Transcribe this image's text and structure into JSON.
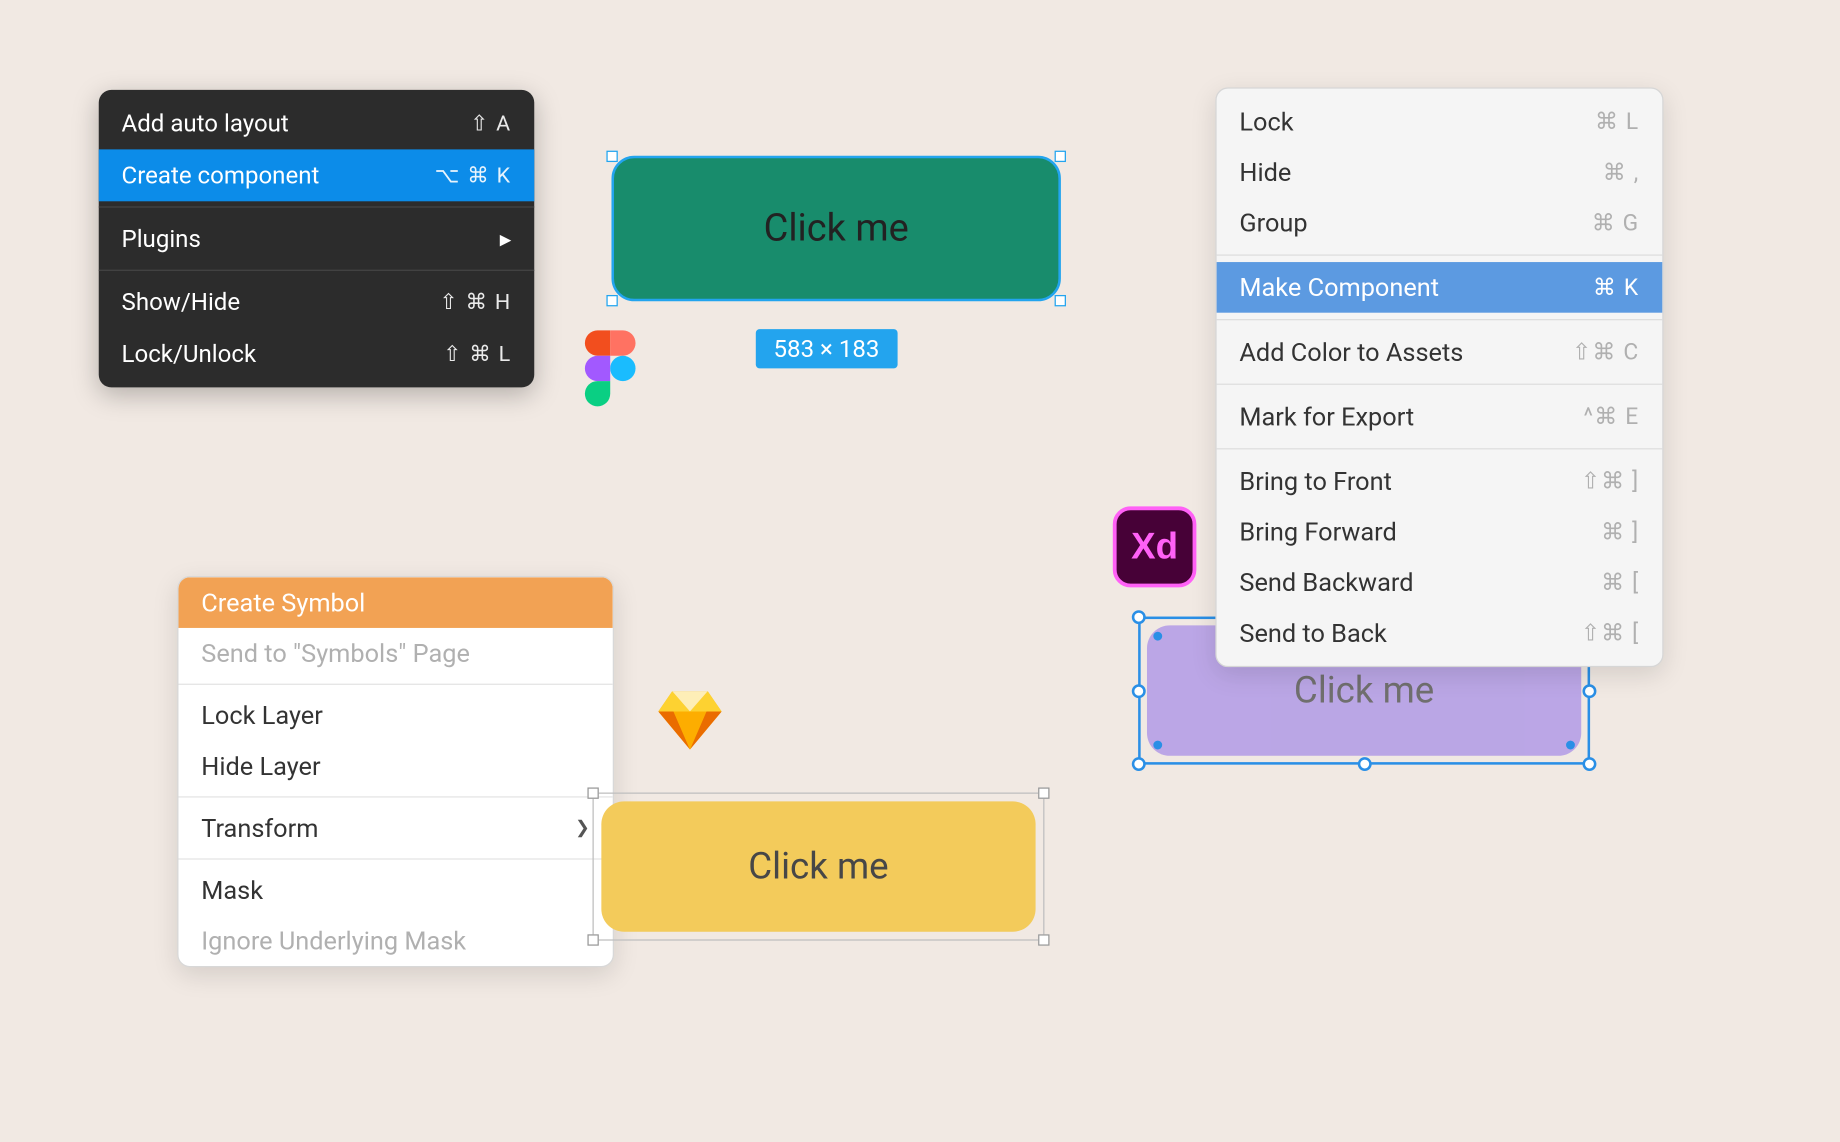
{
  "figma": {
    "menu": {
      "add_auto_layout": {
        "label": "Add auto layout",
        "shortcut": "⇧ A"
      },
      "create_component": {
        "label": "Create component",
        "shortcut": "⌥ ⌘ K"
      },
      "plugins": {
        "label": "Plugins"
      },
      "show_hide": {
        "label": "Show/Hide",
        "shortcut": "⇧ ⌘ H"
      },
      "lock_unlock": {
        "label": "Lock/Unlock",
        "shortcut": "⇧ ⌘ L"
      }
    },
    "object": {
      "label": "Click me",
      "dims": "583 × 183"
    }
  },
  "sketch": {
    "menu": {
      "create_symbol": {
        "label": "Create Symbol"
      },
      "send_to_symbols": {
        "label": "Send to \"Symbols\" Page"
      },
      "lock_layer": {
        "label": "Lock Layer"
      },
      "hide_layer": {
        "label": "Hide Layer"
      },
      "transform": {
        "label": "Transform"
      },
      "mask": {
        "label": "Mask"
      },
      "ignore_mask": {
        "label": "Ignore Underlying Mask"
      }
    },
    "object": {
      "label": "Click me"
    }
  },
  "xd": {
    "menu": {
      "lock": {
        "label": "Lock",
        "shortcut": "⌘ L"
      },
      "hide": {
        "label": "Hide",
        "shortcut": "⌘ ,"
      },
      "group": {
        "label": "Group",
        "shortcut": "⌘ G"
      },
      "make_component": {
        "label": "Make Component",
        "shortcut": "⌘ K"
      },
      "add_color": {
        "label": "Add Color to Assets",
        "shortcut": "⇧⌘ C"
      },
      "mark_export": {
        "label": "Mark for Export",
        "shortcut": "^⌘ E"
      },
      "bring_front": {
        "label": "Bring to Front",
        "shortcut": "⇧⌘ ]"
      },
      "bring_forward": {
        "label": "Bring Forward",
        "shortcut": "⌘ ]"
      },
      "send_backward": {
        "label": "Send Backward",
        "shortcut": "⌘ ["
      },
      "send_back": {
        "label": "Send to Back",
        "shortcut": "⇧⌘ ["
      }
    },
    "object": {
      "label": "Click me"
    },
    "logo_text": "Xd"
  }
}
